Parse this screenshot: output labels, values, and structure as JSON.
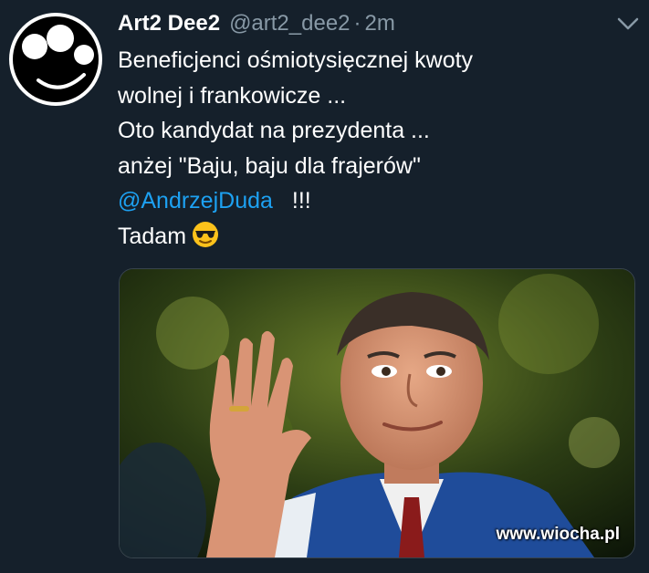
{
  "tweet": {
    "display_name": "Art2 Dee2",
    "handle": "@art2_dee2",
    "separator": "·",
    "time": "2m",
    "lines": [
      "Beneficjenci ośmiotysięcznej kwoty",
      "wolnej i frankowicze ...",
      "Oto kandydat na prezydenta ...",
      "anżej \"Baju, baju dla frajerów\""
    ],
    "mention": "@AndrzejDuda",
    "mention_suffix": "!!!",
    "closing": "Tadam"
  },
  "icons": {
    "avatar": "smiley-face-avatar-icon",
    "caret": "chevron-down-icon",
    "emoji": "sunglasses-smiley-icon"
  },
  "watermark": "www.wiocha.pl",
  "colors": {
    "background": "#15202b",
    "text": "#ffffff",
    "secondary": "#8899a6",
    "mention": "#1da1f2"
  }
}
